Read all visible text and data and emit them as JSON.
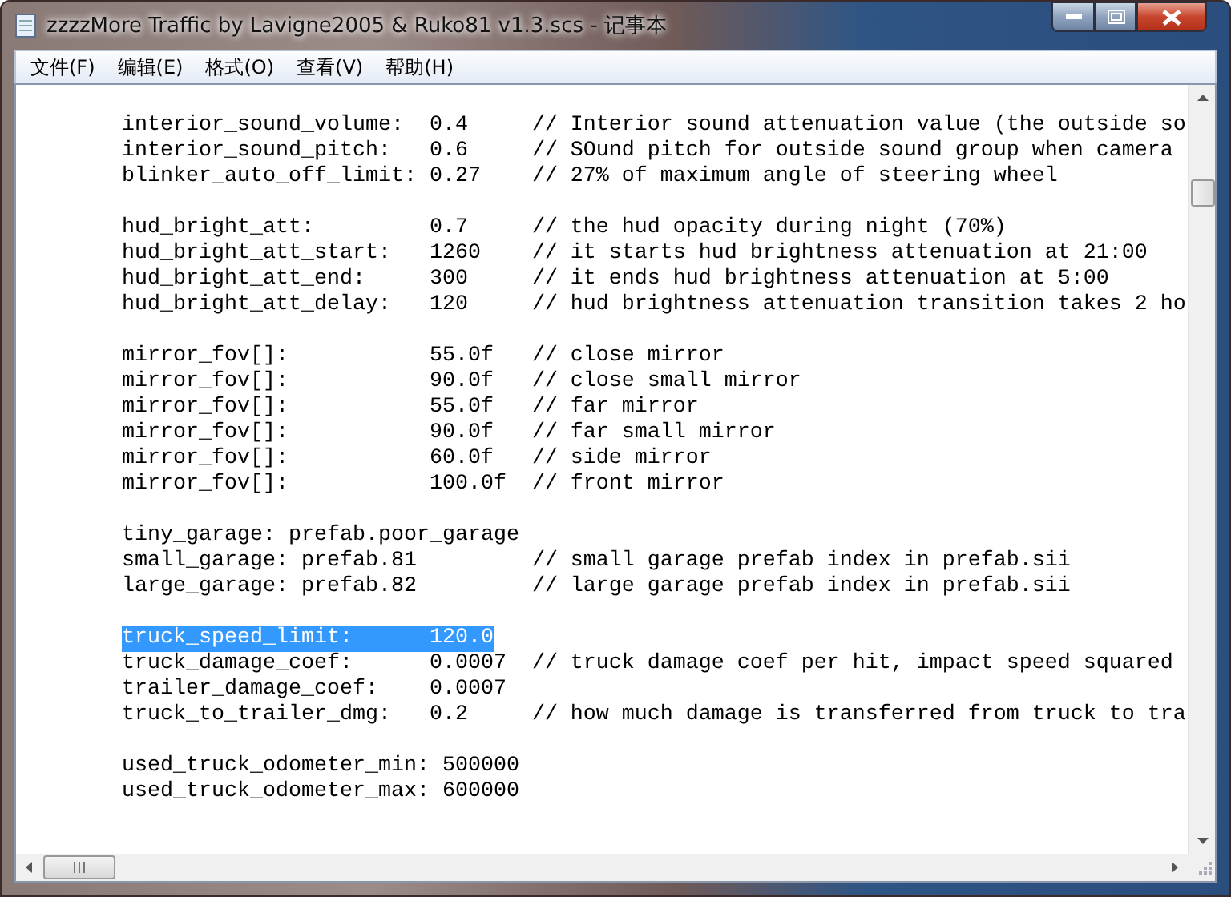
{
  "window": {
    "title": "zzzzMore Traffic by Lavigne2005 & Ruko81 v1.3.scs - 记事本"
  },
  "menu": [
    {
      "label": "文件(F)"
    },
    {
      "label": "编辑(E)"
    },
    {
      "label": "格式(O)"
    },
    {
      "label": "查看(V)"
    },
    {
      "label": "帮助(H)"
    }
  ],
  "editor": {
    "blocks": [
      {
        "lines": [
          {
            "text": "interior_sound_volume:  0.4     // Interior sound attenuation value (the outside so",
            "selected": false
          },
          {
            "text": "interior_sound_pitch:   0.6     // SOund pitch for outside sound group when camera",
            "selected": false
          },
          {
            "text": "blinker_auto_off_limit: 0.27    // 27% of maximum angle of steering wheel",
            "selected": false
          }
        ]
      },
      {
        "lines": [
          {
            "text": "hud_bright_att:         0.7     // the hud opacity during night (70%)",
            "selected": false
          },
          {
            "text": "hud_bright_att_start:   1260    // it starts hud brightness attenuation at 21:00",
            "selected": false
          },
          {
            "text": "hud_bright_att_end:     300     // it ends hud brightness attenuation at 5:00",
            "selected": false
          },
          {
            "text": "hud_bright_att_delay:   120     // hud brightness attenuation transition takes 2 ho",
            "selected": false
          }
        ]
      },
      {
        "lines": [
          {
            "text": "mirror_fov[]:           55.0f   // close mirror",
            "selected": false
          },
          {
            "text": "mirror_fov[]:           90.0f   // close small mirror",
            "selected": false
          },
          {
            "text": "mirror_fov[]:           55.0f   // far mirror",
            "selected": false
          },
          {
            "text": "mirror_fov[]:           90.0f   // far small mirror",
            "selected": false
          },
          {
            "text": "mirror_fov[]:           60.0f   // side mirror",
            "selected": false
          },
          {
            "text": "mirror_fov[]:           100.0f  // front mirror",
            "selected": false
          }
        ]
      },
      {
        "lines": [
          {
            "text": "tiny_garage: prefab.poor_garage",
            "selected": false
          },
          {
            "text": "small_garage: prefab.81         // small garage prefab index in prefab.sii",
            "selected": false
          },
          {
            "text": "large_garage: prefab.82         // large garage prefab index in prefab.sii",
            "selected": false
          }
        ]
      },
      {
        "lines": [
          {
            "text": "truck_speed_limit:      120.0",
            "selected": true
          },
          {
            "text": "truck_damage_coef:      0.0007  // truck damage coef per hit, impact speed squared",
            "selected": false
          },
          {
            "text": "trailer_damage_coef:    0.0007",
            "selected": false
          },
          {
            "text": "truck_to_trailer_dmg:   0.2     // how much damage is transferred from truck to tra",
            "selected": false
          }
        ]
      },
      {
        "lines": [
          {
            "text": "used_truck_odometer_min: 500000",
            "selected": false
          },
          {
            "text": "used_truck_odometer_max: 600000",
            "selected": false
          }
        ]
      }
    ]
  }
}
